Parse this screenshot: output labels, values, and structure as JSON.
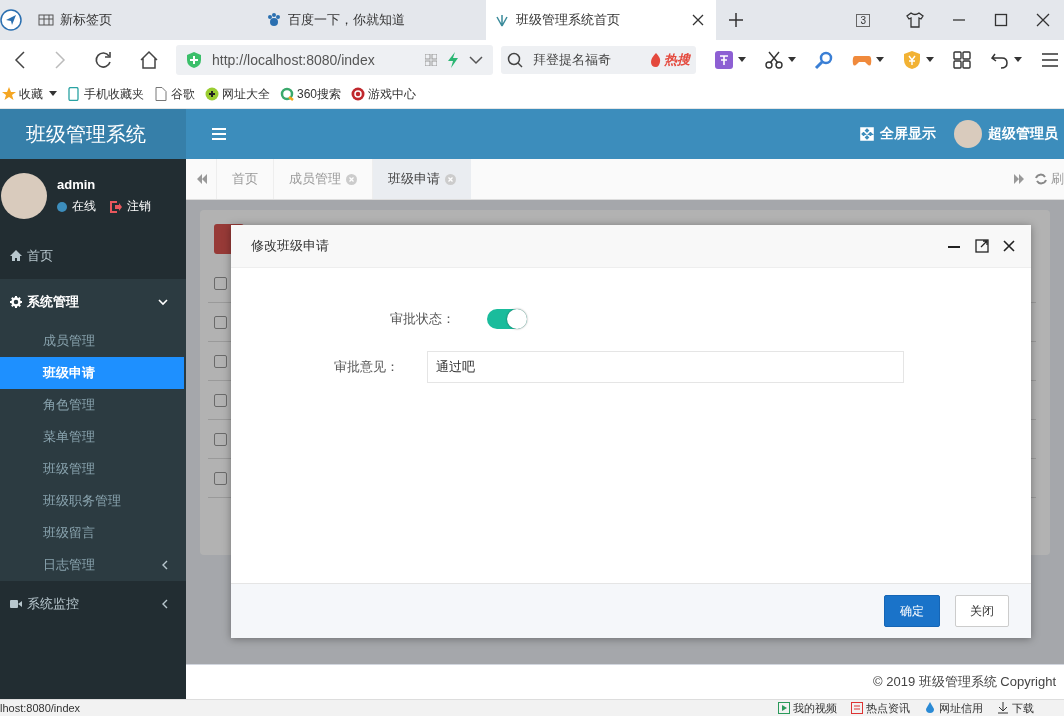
{
  "browser": {
    "tabs": [
      {
        "title": "新标签页",
        "selected": false
      },
      {
        "title": "百度一下，你就知道",
        "selected": false
      },
      {
        "title": "班级管理系统首页",
        "selected": true
      }
    ],
    "tab_count": "3",
    "address": "http://localhost:8080/index",
    "search": {
      "value": "拜登提名福奇",
      "hot_label": "热搜"
    },
    "bookmarks": [
      "收藏",
      "手机收藏夹",
      "谷歌",
      "网址大全",
      "360搜索",
      "游戏中心"
    ]
  },
  "app": {
    "title": "班级管理系统",
    "fullscreen": "全屏显示",
    "user": "超级管理员",
    "user_panel": {
      "name": "admin",
      "status": "在线",
      "logout": "注销"
    },
    "sidebar": [
      {
        "label": "首页",
        "kind": "link"
      },
      {
        "label": "系统管理",
        "kind": "group",
        "expanded": true,
        "children": [
          {
            "label": "成员管理",
            "kind": "link",
            "selected": false
          },
          {
            "label": "班级申请",
            "kind": "link",
            "selected": true
          },
          {
            "label": "角色管理",
            "kind": "link",
            "selected": false
          },
          {
            "label": "菜单管理",
            "kind": "link",
            "selected": false
          },
          {
            "label": "班级管理",
            "kind": "link",
            "selected": false
          },
          {
            "label": "班级职务管理",
            "kind": "link",
            "selected": false
          },
          {
            "label": "班级留言",
            "kind": "link",
            "selected": false
          },
          {
            "label": "日志管理",
            "kind": "group",
            "expanded": false,
            "selected": false
          }
        ]
      },
      {
        "label": "系统监控",
        "kind": "group",
        "expanded": false
      }
    ],
    "content_tabs": [
      {
        "label": "首页",
        "closable": false,
        "selected": false
      },
      {
        "label": "成员管理",
        "closable": true,
        "selected": false
      },
      {
        "label": "班级申请",
        "closable": true,
        "selected": true
      }
    ],
    "refresh": "刷",
    "table": {
      "rows": [
        {
          "checked": false
        },
        {
          "checked": false
        },
        {
          "checked": false
        },
        {
          "checked": false
        },
        {
          "checked": false
        },
        {
          "checked": false
        }
      ]
    },
    "dialog": {
      "title": "修改班级申请",
      "fields": [
        {
          "kind": "switch",
          "label": "审批状态：",
          "on": true
        },
        {
          "kind": "text",
          "label": "审批意见：",
          "value": "通过吧"
        }
      ],
      "buttons": [
        {
          "label": "确定",
          "kind": "primary"
        },
        {
          "label": "关闭",
          "kind": "default"
        }
      ]
    },
    "footer": "© 2019 班级管理系统 Copyright"
  },
  "status_bar": {
    "url": "lhost:8080/index",
    "items": [
      "我的视频",
      "热点资讯",
      "网址信用",
      "下载"
    ]
  }
}
